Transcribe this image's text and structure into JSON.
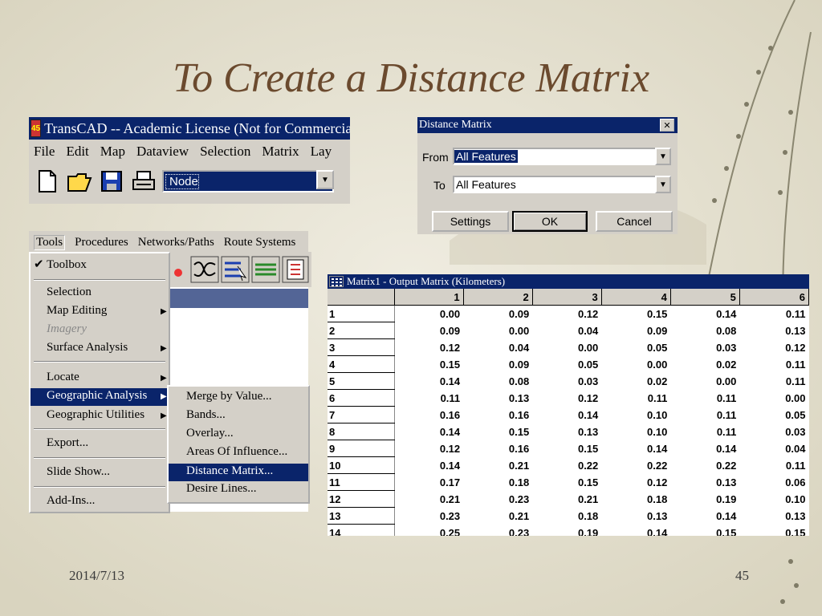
{
  "slide": {
    "title": "To Create a Distance Matrix",
    "date": "2014/7/13",
    "page": "45"
  },
  "transcad": {
    "logo": "45",
    "title": "TransCAD -- Academic License (Not for Commercial",
    "menus": [
      "File",
      "Edit",
      "Map",
      "Dataview",
      "Selection",
      "Matrix",
      "Lay"
    ],
    "layer_value": "Node",
    "toolbar_icons": [
      "new-file-icon",
      "open-folder-icon",
      "save-icon",
      "print-icon"
    ]
  },
  "tools_area": {
    "menubar": [
      "Tools",
      "Procedures",
      "Networks/Paths",
      "Route Systems"
    ],
    "menu": {
      "toolbox": "Toolbox",
      "selection": "Selection",
      "map_editing": "Map Editing",
      "imagery": "Imagery",
      "surface_analysis": "Surface Analysis",
      "locate": "Locate",
      "geographic_analysis": "Geographic Analysis",
      "geographic_utilities": "Geographic Utilities",
      "export": "Export...",
      "slide_show": "Slide Show...",
      "add_ins": "Add-Ins..."
    },
    "submenu": {
      "merge_by_value": "Merge by Value...",
      "bands": "Bands...",
      "overlay": "Overlay...",
      "areas_of_influence": "Areas Of Influence...",
      "distance_matrix": "Distance Matrix...",
      "desire_lines": "Desire Lines..."
    }
  },
  "distance_dialog": {
    "title": "Distance Matrix",
    "from_label": "From",
    "from_value": "All Features",
    "to_label": "To",
    "to_value": "All Features",
    "settings": "Settings",
    "ok": "OK",
    "cancel": "Cancel"
  },
  "matrix_window": {
    "title": "Matrix1 - Output Matrix (Kilometers)",
    "columns": [
      "1",
      "2",
      "3",
      "4",
      "5",
      "6"
    ],
    "rows": [
      {
        "id": "1",
        "values": [
          "0.00",
          "0.09",
          "0.12",
          "0.15",
          "0.14",
          "0.11"
        ]
      },
      {
        "id": "2",
        "values": [
          "0.09",
          "0.00",
          "0.04",
          "0.09",
          "0.08",
          "0.13"
        ]
      },
      {
        "id": "3",
        "values": [
          "0.12",
          "0.04",
          "0.00",
          "0.05",
          "0.03",
          "0.12"
        ]
      },
      {
        "id": "4",
        "values": [
          "0.15",
          "0.09",
          "0.05",
          "0.00",
          "0.02",
          "0.11"
        ]
      },
      {
        "id": "5",
        "values": [
          "0.14",
          "0.08",
          "0.03",
          "0.02",
          "0.00",
          "0.11"
        ]
      },
      {
        "id": "6",
        "values": [
          "0.11",
          "0.13",
          "0.12",
          "0.11",
          "0.11",
          "0.00"
        ]
      },
      {
        "id": "7",
        "values": [
          "0.16",
          "0.16",
          "0.14",
          "0.10",
          "0.11",
          "0.05"
        ]
      },
      {
        "id": "8",
        "values": [
          "0.14",
          "0.15",
          "0.13",
          "0.10",
          "0.11",
          "0.03"
        ]
      },
      {
        "id": "9",
        "values": [
          "0.12",
          "0.16",
          "0.15",
          "0.14",
          "0.14",
          "0.04"
        ]
      },
      {
        "id": "10",
        "values": [
          "0.14",
          "0.21",
          "0.22",
          "0.22",
          "0.22",
          "0.11"
        ]
      },
      {
        "id": "11",
        "values": [
          "0.17",
          "0.18",
          "0.15",
          "0.12",
          "0.13",
          "0.06"
        ]
      },
      {
        "id": "12",
        "values": [
          "0.21",
          "0.23",
          "0.21",
          "0.18",
          "0.19",
          "0.10"
        ]
      },
      {
        "id": "13",
        "values": [
          "0.23",
          "0.21",
          "0.18",
          "0.13",
          "0.14",
          "0.13"
        ]
      },
      {
        "id": "14",
        "values": [
          "0.25",
          "0.23",
          "0.19",
          "0.14",
          "0.15",
          "0.15"
        ]
      }
    ]
  },
  "colors": {
    "title_text": "#6b4a2e",
    "win_title": "#0a246a",
    "win_face": "#d4d0c8"
  }
}
